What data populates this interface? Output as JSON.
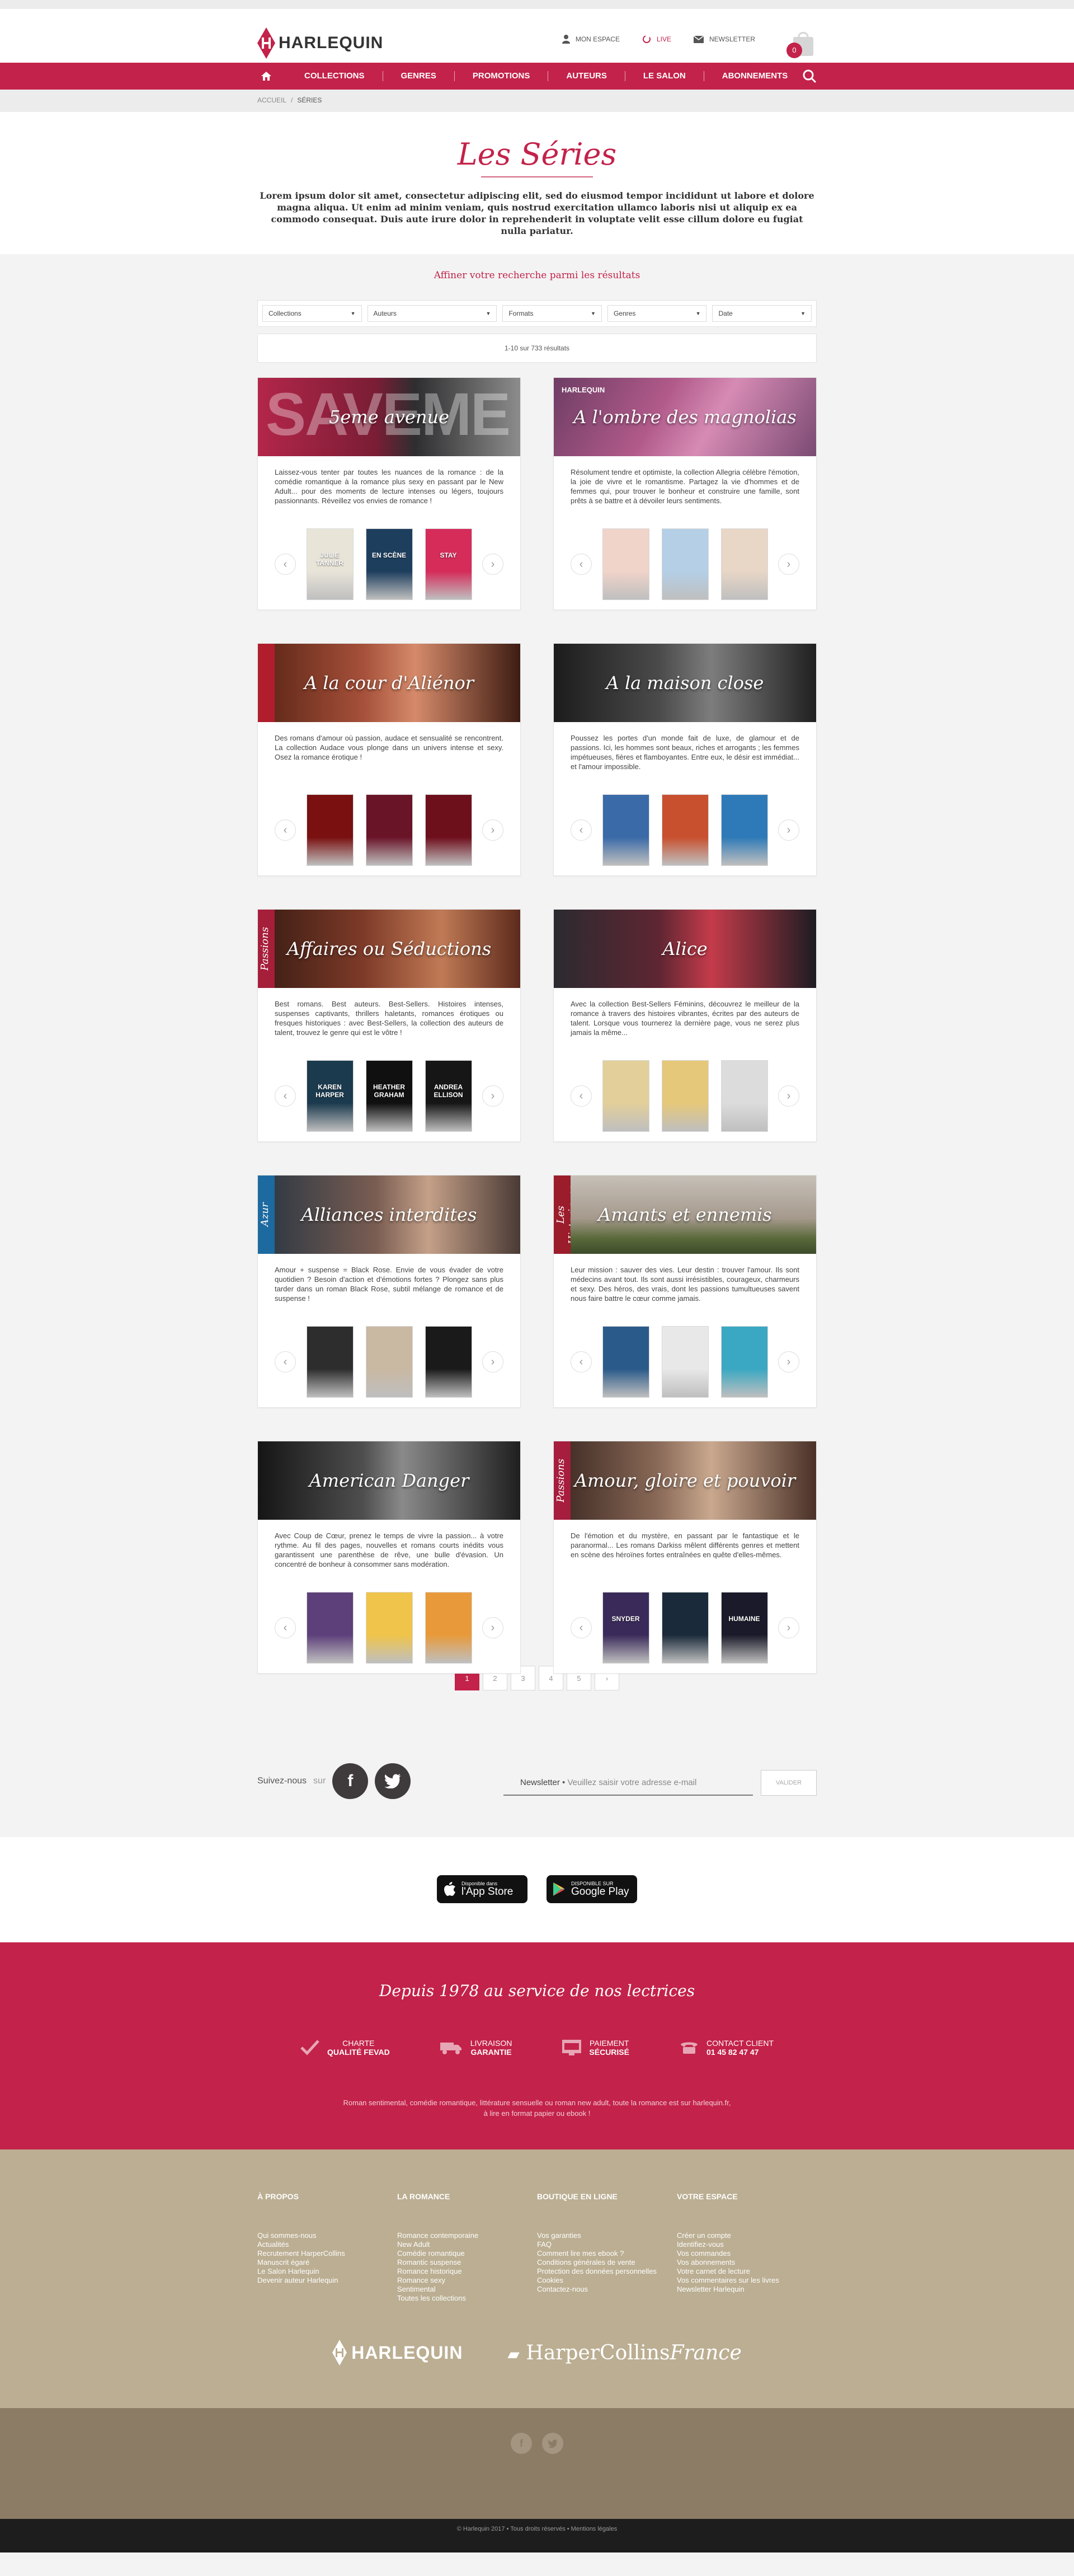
{
  "header": {
    "logo_text": "HARLEQUIN",
    "links": [
      {
        "label": "MON ESPACE",
        "icon": "user-icon"
      },
      {
        "label": "LIVE",
        "icon": "live-icon"
      },
      {
        "label": "NEWSLETTER",
        "icon": "mail-icon"
      }
    ],
    "cart_count": "0"
  },
  "nav": {
    "items": [
      "COLLECTIONS",
      "GENRES",
      "PROMOTIONS",
      "AUTEURS",
      "LE SALON",
      "ABONNEMENTS"
    ]
  },
  "breadcrumb": {
    "home": "ACCUEIL",
    "sep": "/",
    "current": "SÉRIES"
  },
  "intro": {
    "title": "Les Séries",
    "text": "Lorem ipsum dolor sit amet, consectetur adipiscing elit, sed do eiusmod tempor incididunt ut labore et dolore magna aliqua. Ut enim ad minim veniam, quis nostrud exercitation ullamco laboris nisi ut aliquip ex ea commodo consequat. Duis aute irure dolor in reprehenderit in voluptate velit esse cillum dolore eu fugiat nulla pariatur."
  },
  "filters": {
    "title": "Affiner votre recherche parmi les résultats",
    "selects": [
      "Collections",
      "Auteurs",
      "Formats",
      "Genres",
      "Date"
    ],
    "results": "1-10 sur 733 résultats"
  },
  "series": [
    {
      "name": "5eme avenue",
      "banner_text": "SAVEME",
      "desc": "Laissez-vous tenter par toutes les nuances de la romance : de la comédie romantique à la romance plus sexy en passant par le New Adult... pour des moments de lecture intenses ou légers, toujours passionnants. Réveillez vos envies de romance !"
    },
    {
      "name": "A l'ombre des magnolias",
      "banner_text": "HARLEQUIN",
      "desc": "Résolument tendre et optimiste, la collection Allegria célèbre l'émotion, la joie de vivre et le romantisme. Partagez la vie d'hommes et de femmes qui, pour trouver le bonheur et construire une famille, sont prêts à se battre et à dévoiler leurs sentiments."
    },
    {
      "name": "A la cour d'Aliénor",
      "banner_text": "",
      "desc": "Des romans d'amour où passion, audace et sensualité se rencontrent. La collection Audace vous plonge dans un univers intense et sexy. Osez la romance érotique !"
    },
    {
      "name": "A la maison close",
      "banner_text": "",
      "desc": "Poussez les portes d'un monde fait de luxe, de glamour et de passions. Ici, les hommes sont beaux, riches et arrogants ; les femmes impétueuses, fières et flamboyantes. Entre eux, le désir est immédiat... et l'amour impossible."
    },
    {
      "name": "Affaires ou Séductions",
      "banner_text": "Passions",
      "desc": "Best romans. Best auteurs. Best-Sellers. Histoires intenses, suspenses captivants, thrillers haletants, romances érotiques ou fresques historiques : avec Best-Sellers, la collection des auteurs de talent, trouvez le genre qui est le vôtre !"
    },
    {
      "name": "Alice",
      "banner_text": "",
      "desc": "Avec la collection Best-Sellers Féminins, découvrez le meilleur de la romance à travers des histoires vibrantes, écrites par des auteurs de talent. Lorsque vous tournerez la dernière page, vous ne serez plus jamais la même..."
    },
    {
      "name": "Alliances interdites",
      "banner_text": "Azur",
      "desc": "Amour + suspense = Black Rose. Envie de vous évader de votre quotidien ? Besoin d'action et d'émotions fortes ? Plongez sans plus tarder dans un roman Black Rose, subtil mélange de romance et de suspense !"
    },
    {
      "name": "Amants et ennemis",
      "banner_text": "Les Historiques",
      "desc": "Leur mission : sauver des vies. Leur destin : trouver l'amour. Ils sont médecins avant tout. Ils sont aussi irrésistibles, courageux, charmeurs et sexy. Des héros, des vrais, dont les passions tumultueuses savent nous faire battre le cœur comme jamais."
    },
    {
      "name": "American Danger",
      "banner_text": "",
      "desc": "Avec Coup de Cœur, prenez le temps de vivre la passion... à votre rythme. Au fil des pages, nouvelles et romans courts inédits vous garantissent une parenthèse de rêve, une bulle d'évasion. Un concentré de bonheur à consommer sans modération."
    },
    {
      "name": "Amour, gloire et pouvoir",
      "banner_text": "Passions",
      "desc": "De l'émotion et du mystère, en passant par le fantastique et le paranormal... Les romans Darkiss mêlent différents genres et mettent en scène des héroïnes fortes entraînées en quête d'elles-mêmes."
    }
  ],
  "books": [
    [
      "JULIE TANNER",
      "EN SCÈNE",
      "STAY"
    ],
    [
      "",
      "",
      ""
    ],
    [
      "",
      "",
      ""
    ],
    [
      "",
      "",
      ""
    ],
    [
      "KAREN HARPER",
      "HEATHER GRAHAM",
      "ANDREA ELLISON"
    ],
    [
      "",
      "",
      ""
    ],
    [
      "",
      "",
      ""
    ],
    [
      "",
      "",
      ""
    ],
    [
      "",
      "",
      ""
    ],
    [
      "SNYDER",
      "",
      "HUMAINE"
    ]
  ],
  "pagination": [
    "1",
    "2",
    "3",
    "4",
    "5",
    "›"
  ],
  "social": {
    "follow": "Suivez-nous",
    "on": "sur",
    "newsletter_label": "Newsletter",
    "newsletter_placeholder": "Veuillez saisir votre adresse e-mail",
    "newsletter_button": "VALIDER"
  },
  "apps": {
    "appstore_small": "Disponible dans",
    "appstore_big": "l'App Store",
    "google_small": "DISPONIBLE SUR",
    "google_big": "Google Play"
  },
  "pink": {
    "title": "Depuis 1978 au service de nos lectrices",
    "features": [
      {
        "l1": "CHARTE",
        "l2": "QUALITÉ FEVAD"
      },
      {
        "l1": "LIVRAISON",
        "l2": "GARANTIE"
      },
      {
        "l1": "PAIEMENT",
        "l2": "SÉCURISÉ"
      },
      {
        "l1": "CONTACT CLIENT",
        "l2": "01 45 82 47 47"
      }
    ],
    "tagline1": "Roman sentimental, comédie romantique, littérature sensuelle ou roman new adult, toute la romance est sur harlequin.fr,",
    "tagline2": "à lire en format papier ou ebook !"
  },
  "footer": {
    "columns": [
      {
        "title": "À PROPOS",
        "items": [
          "Qui sommes-nous",
          "Actualités",
          "Recrutement HarperCollins",
          "Manuscrit égaré",
          "Le Salon Harlequin",
          "Devenir auteur Harlequin"
        ]
      },
      {
        "title": "LA ROMANCE",
        "items": [
          "Romance contemporaine",
          "New Adult",
          "Comédie romantique",
          "Romantic suspense",
          "Romance historique",
          "Romance sexy",
          "Sentimental",
          "Toutes les collections"
        ]
      },
      {
        "title": "BOUTIQUE EN LIGNE",
        "items": [
          "Vos garanties",
          "FAQ",
          "Comment lire mes ebook ?",
          "Conditions générales de vente",
          "Protection des données personnelles",
          "Cookies",
          "Contactez-nous"
        ]
      },
      {
        "title": "VOTRE ESPACE",
        "items": [
          "Créer un compte",
          "Identifiez-vous",
          "Vos commandes",
          "Vos abonnements",
          "Votre carnet de lecture",
          "Vos commentaires sur les livres",
          "Newsletter Harlequin"
        ]
      }
    ],
    "logo1": "HARLEQUIN",
    "logo2a": "HarperCollins",
    "logo2b": "France",
    "copyright": "© Harlequin 2017 • Tous droits réservés • Mentions légales"
  },
  "colors": {
    "brand": "#c3224a",
    "beige": "#bbae92",
    "brown": "#8c7c66"
  }
}
